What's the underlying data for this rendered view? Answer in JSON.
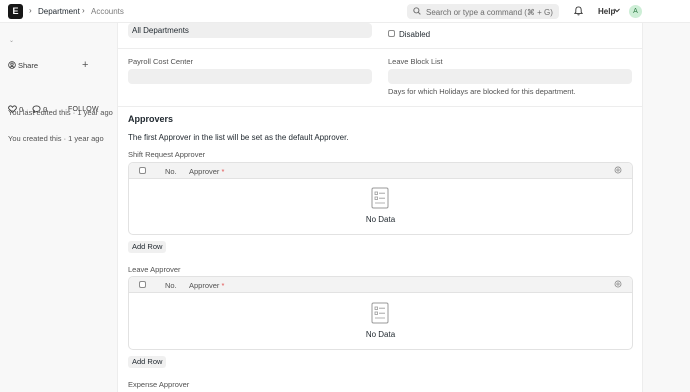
{
  "navbar": {
    "logo": "E",
    "breadcrumbs": [
      "Department",
      "Accounts"
    ],
    "search_placeholder": "Search or type a command (⌘ + G)",
    "help_label": "Help",
    "avatar_initial": "A"
  },
  "sidebar": {
    "share_label": "Share",
    "likes_count": "0",
    "comments_count": "0",
    "follow_label": "FOLLOW",
    "last_edited": "You last edited this · 1 year ago",
    "created": "You created this · 1 year ago"
  },
  "form": {
    "parent_department_value": "All Departments",
    "disabled_label": "Disabled",
    "payroll_cost_center_label": "Payroll Cost Center",
    "leave_block_list_label": "Leave Block List",
    "leave_block_list_desc": "Days for which Holidays are blocked for this department.",
    "approvers_title": "Approvers",
    "approvers_note": "The first Approver in the list will be set as the default Approver.",
    "tables": [
      {
        "label": "Shift Request Approver",
        "col_no": "No.",
        "col_approver": "Approver",
        "empty_text": "No Data",
        "add_row": "Add Row"
      },
      {
        "label": "Leave Approver",
        "col_no": "No.",
        "col_approver": "Approver",
        "empty_text": "No Data",
        "add_row": "Add Row"
      }
    ],
    "expense_approver_label": "Expense Approver"
  }
}
